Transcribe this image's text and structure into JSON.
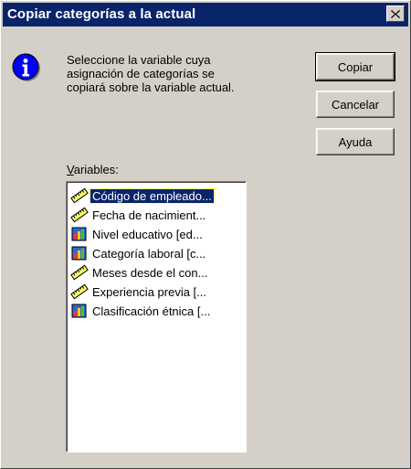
{
  "window": {
    "title": "Copiar categorías a la actual"
  },
  "message": {
    "lines": [
      "Seleccione la variable cuya",
      "asignación de categorías se",
      "copiará sobre la variable actual."
    ]
  },
  "buttons": {
    "copy": "Copiar",
    "cancel": "Cancelar",
    "help": "Ayuda"
  },
  "variables": {
    "label_accel": "V",
    "label_rest": "ariables:",
    "items": [
      {
        "label": "Código de empleado...",
        "icon": "scale-ruler-icon",
        "selected": true
      },
      {
        "label": "Fecha de nacimient...",
        "icon": "scale-ruler-icon",
        "selected": false
      },
      {
        "label": "Nivel educativo [ed...",
        "icon": "ordinal-bars-icon",
        "selected": false
      },
      {
        "label": "Categoría laboral [c...",
        "icon": "ordinal-bars-icon",
        "selected": false
      },
      {
        "label": "Meses desde el con...",
        "icon": "scale-ruler-icon",
        "selected": false
      },
      {
        "label": "Experiencia previa [...",
        "icon": "scale-ruler-icon",
        "selected": false
      },
      {
        "label": "Clasificación étnica [...",
        "icon": "ordinal-bars-icon",
        "selected": false
      }
    ]
  },
  "colors": {
    "titlebar": "#0a246a",
    "face": "#d4d0c8",
    "selection": "#0a246a"
  }
}
